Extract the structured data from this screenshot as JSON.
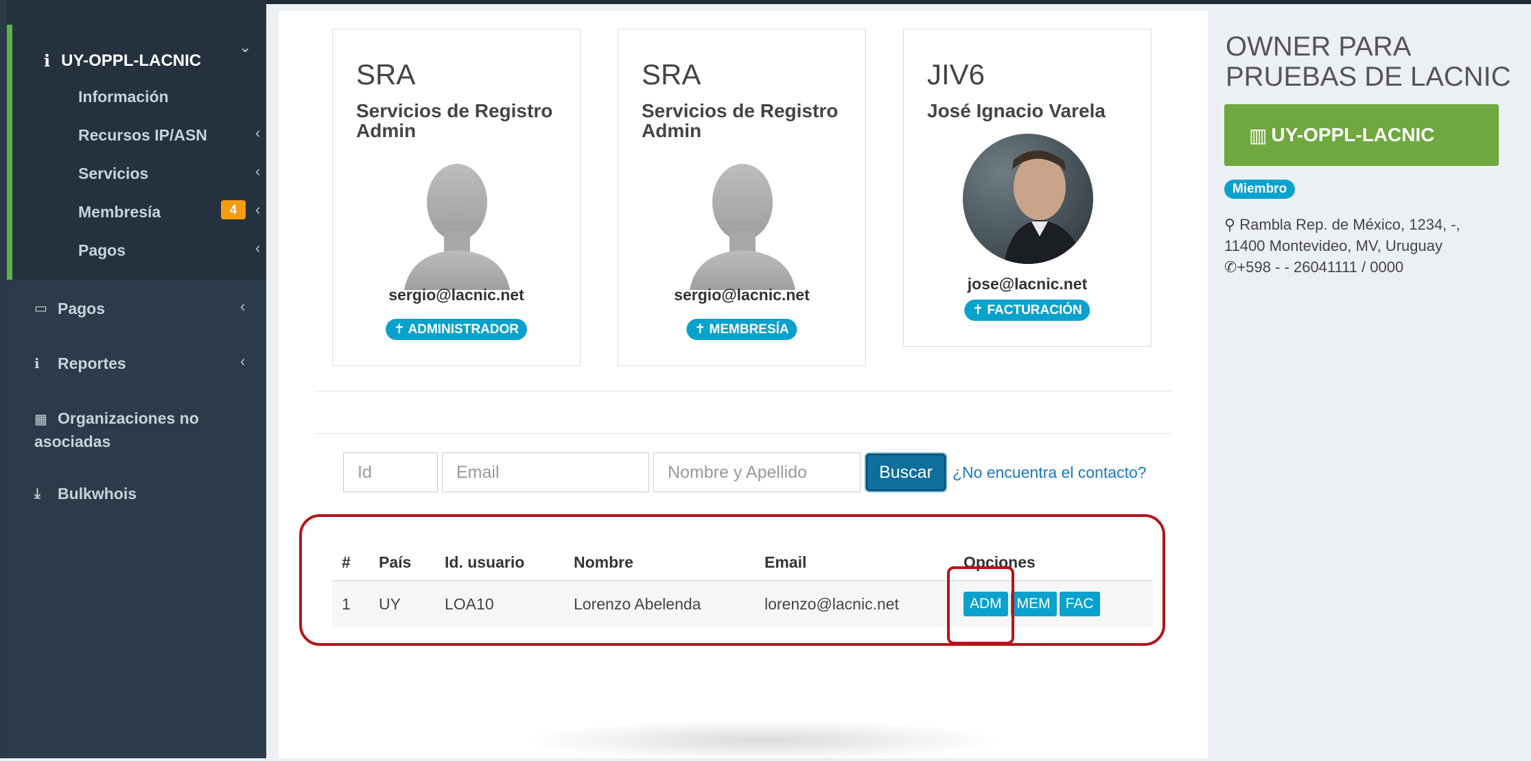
{
  "sidebar": {
    "org_menu": {
      "title": "UY-OPPL-LACNIC",
      "items": [
        {
          "label": "Información"
        },
        {
          "label": "Recursos IP/ASN"
        },
        {
          "label": "Servicios"
        },
        {
          "label": "Membresía",
          "badge": "4"
        },
        {
          "label": "Pagos"
        }
      ]
    },
    "nav": [
      {
        "label": "Pagos",
        "icon": "money-icon"
      },
      {
        "label": "Reportes",
        "icon": "info-icon"
      },
      {
        "label": "Organizaciones no asociadas",
        "icon": "grid-icon"
      },
      {
        "label": "Bulkwhois",
        "icon": "download-icon"
      }
    ]
  },
  "contacts": [
    {
      "code": "SRA",
      "name": "Servicios de Registro Admin",
      "email": "sergio@lacnic.net",
      "role": "ADMINISTRADOR"
    },
    {
      "code": "SRA",
      "name": "Servicios de Registro Admin",
      "email": "sergio@lacnic.net",
      "role": "MEMBRESÍA"
    },
    {
      "code": "JIV6",
      "name": "José Ignacio Varela",
      "email": "jose@lacnic.net",
      "role": "FACTURACIÓN"
    }
  ],
  "search": {
    "id_placeholder": "Id",
    "email_placeholder": "Email",
    "name_placeholder": "Nombre y Apellido",
    "button": "Buscar",
    "not_found_link": "¿No encuentra el contacto?"
  },
  "results": {
    "headers": [
      "#",
      "País",
      "Id. usuario",
      "Nombre",
      "Email",
      "Opciones"
    ],
    "rows": [
      {
        "num": "1",
        "country": "UY",
        "user_id": "LOA10",
        "name": "Lorenzo Abelenda",
        "email": "lorenzo@lacnic.net",
        "options": [
          "ADM",
          "MEM",
          "FAC"
        ]
      }
    ]
  },
  "owner": {
    "title": "OWNER PARA PRUEBAS DE LACNIC",
    "handle": "UY-OPPL-LACNIC",
    "status": "Miembro",
    "address": "Rambla Rep. de México, 1234, -, 11400 Montevideo, MV, Uruguay",
    "phone": "+598 - - 26041111 / 0000"
  },
  "colors": {
    "sidebar_bg": "#2c3b49",
    "accent_green": "#6ea83e",
    "badge_cyan": "#0aa2cc",
    "annotation_red": "#b8121a"
  }
}
